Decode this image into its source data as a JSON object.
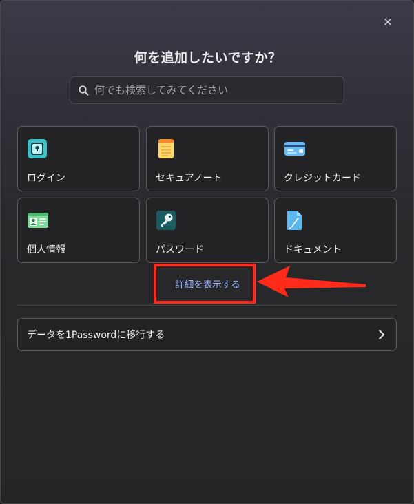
{
  "dialog": {
    "title": "何を追加したいですか？",
    "close_symbol": "✕"
  },
  "search": {
    "placeholder": "何でも検索してみてください",
    "icon": "search-icon"
  },
  "items": [
    {
      "label": "ログイン",
      "icon": "login-lock-icon"
    },
    {
      "label": "セキュアノート",
      "icon": "secure-note-icon"
    },
    {
      "label": "クレジットカード",
      "icon": "credit-card-icon"
    },
    {
      "label": "個人情報",
      "icon": "identity-card-icon"
    },
    {
      "label": "パスワード",
      "icon": "key-icon"
    },
    {
      "label": "ドキュメント",
      "icon": "document-icon"
    }
  ],
  "show_details": {
    "label": "詳細を表示する"
  },
  "migrate": {
    "label": "データを1Passwordに移行する",
    "icon": "chevron-right-icon"
  },
  "colors": {
    "accent_link": "#9db8ff",
    "annotation_red": "#ff2a1a"
  }
}
